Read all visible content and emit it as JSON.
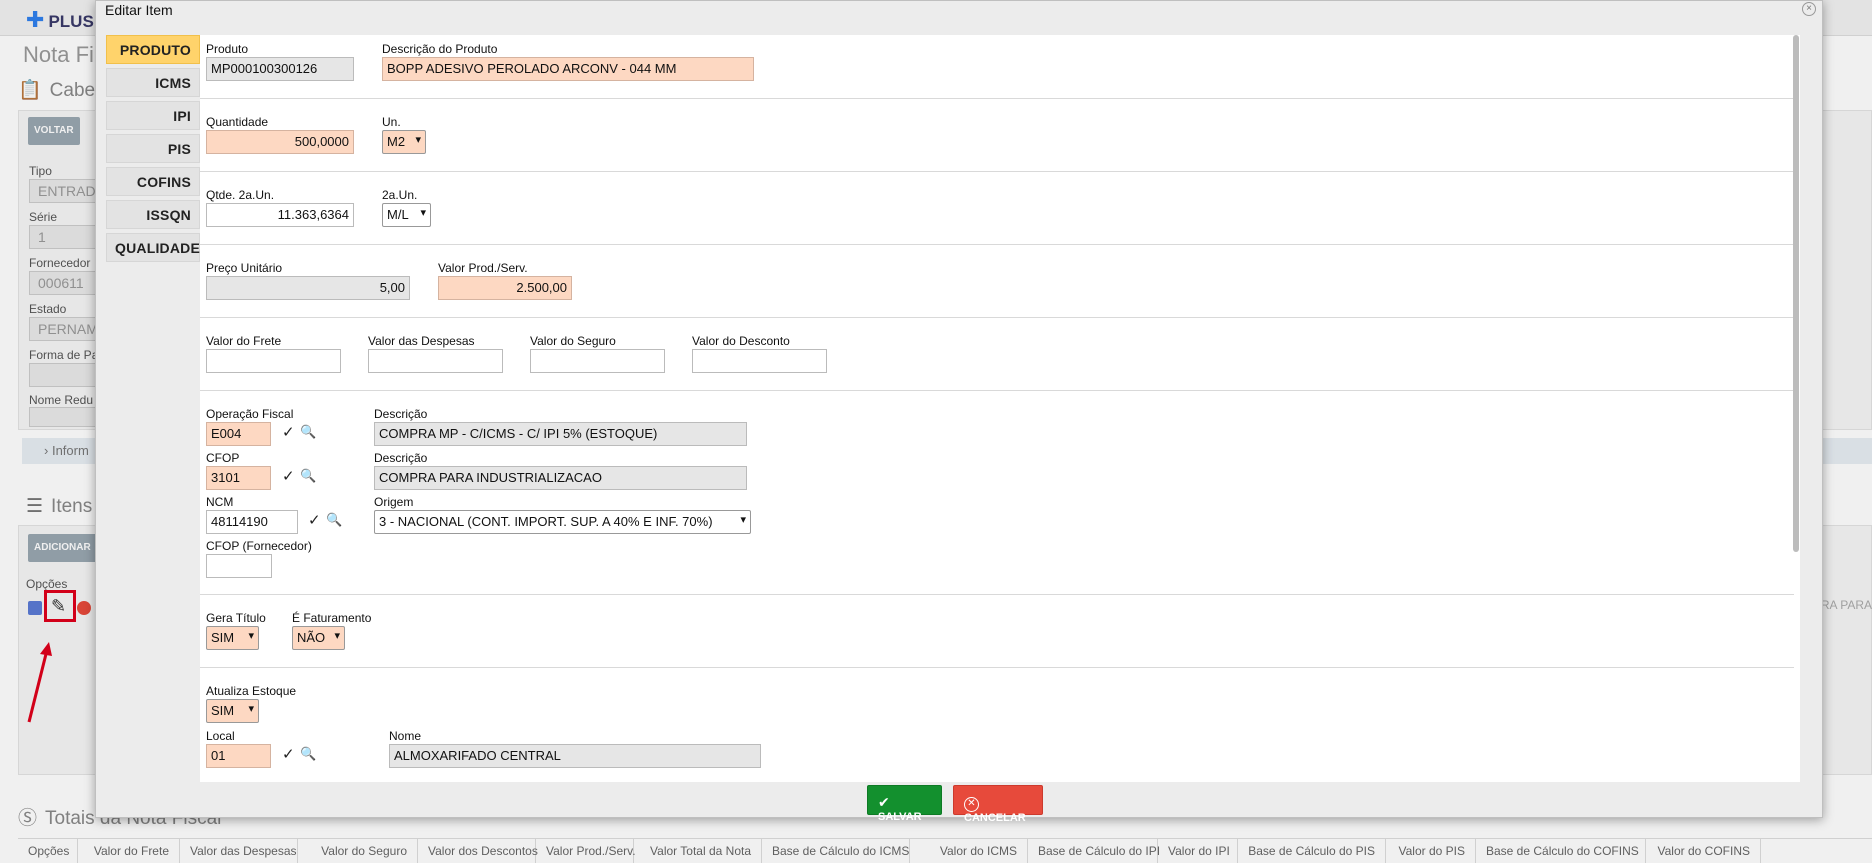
{
  "background": {
    "logo": "PLUS",
    "page_title": "Nota Fi",
    "section_cabecalho": "Cabe",
    "btn_voltar": "VOLTAR",
    "fields": [
      {
        "label": "Tipo",
        "value": "ENTRAD"
      },
      {
        "label": "Série",
        "value": "1"
      },
      {
        "label": "Fornecedor",
        "value": "000611"
      },
      {
        "label": "Estado",
        "value": "PERNAM"
      },
      {
        "label": "Forma de Pa",
        "value": ""
      },
      {
        "label": "Nome Redu",
        "value": ""
      }
    ],
    "info_link": "Inform",
    "section_itens": "Itens",
    "btn_adicionar": "ADICIONAR",
    "opcoes_label": "Opções",
    "right_partial": "RA PARA",
    "section_totais": "Totais da Nota Fiscal",
    "totals_columns": [
      "Opções",
      "Valor do Frete",
      "Valor das Despesas",
      "Valor do Seguro",
      "Valor dos Descontos",
      "Valor Prod./Serv.",
      "Valor Total da Nota",
      "Base de Cálculo do ICMS",
      "Valor do ICMS",
      "Base de Cálculo do IPI",
      "Valor do IPI",
      "Base de Cálculo do PIS",
      "Valor do PIS",
      "Base de Cálculo do COFINS",
      "Valor do COFINS"
    ]
  },
  "modal": {
    "title": "Editar Item",
    "close": "×",
    "tabs": [
      "PRODUTO",
      "ICMS",
      "IPI",
      "PIS",
      "COFINS",
      "ISSQN",
      "QUALIDADE"
    ],
    "active_tab": "PRODUTO",
    "produto": {
      "label": "Produto",
      "value": "MP000100300126"
    },
    "descricao_produto": {
      "label": "Descrição do Produto",
      "value": "BOPP ADESIVO PEROLADO ARCONV - 044 MM"
    },
    "quantidade": {
      "label": "Quantidade",
      "value": "500,0000"
    },
    "un": {
      "label": "Un.",
      "value": "M2"
    },
    "qtde_2a": {
      "label": "Qtde. 2a.Un.",
      "value": "11.363,6364"
    },
    "un_2a": {
      "label": "2a.Un.",
      "value": "M/L"
    },
    "preco_unitario": {
      "label": "Preço Unitário",
      "value": "5,00"
    },
    "valor_prod": {
      "label": "Valor Prod./Serv.",
      "value": "2.500,00"
    },
    "valor_frete": {
      "label": "Valor do Frete",
      "value": ""
    },
    "valor_despesas": {
      "label": "Valor das Despesas",
      "value": ""
    },
    "valor_seguro": {
      "label": "Valor do Seguro",
      "value": ""
    },
    "valor_desconto": {
      "label": "Valor do Desconto",
      "value": ""
    },
    "operacao_fiscal": {
      "label": "Operação Fiscal",
      "value": "E004"
    },
    "descricao_op": {
      "label": "Descrição",
      "value": "COMPRA MP - C/ICMS - C/ IPI 5% (ESTOQUE)"
    },
    "cfop": {
      "label": "CFOP",
      "value": "3101"
    },
    "descricao_cfop": {
      "label": "Descrição",
      "value": "COMPRA PARA INDUSTRIALIZACAO"
    },
    "ncm": {
      "label": "NCM",
      "value": "48114190"
    },
    "origem": {
      "label": "Origem",
      "value": "3 - NACIONAL (CONT. IMPORT. SUP. A 40% E INF. 70%)"
    },
    "cfop_fornecedor": {
      "label": "CFOP (Fornecedor)",
      "value": ""
    },
    "gera_titulo": {
      "label": "Gera Título",
      "value": "SIM"
    },
    "e_faturamento": {
      "label": "É Faturamento",
      "value": "NÃO"
    },
    "atualiza_estoque": {
      "label": "Atualiza Estoque",
      "value": "SIM"
    },
    "local": {
      "label": "Local",
      "value": "01"
    },
    "nome_local": {
      "label": "Nome",
      "value": "ALMOXARIFADO CENTRAL"
    },
    "buttons": {
      "save": "SALVAR",
      "cancel": "CANCELAR"
    }
  },
  "colors": {
    "required_field": "#fdd8c2",
    "active_tab": "#ffd36b",
    "save": "#13902e",
    "cancel": "#e74a3b",
    "highlight": "#e0001b"
  },
  "icons": {
    "confirm": "check-icon",
    "search": "magnifier-icon",
    "edit": "pencil-icon",
    "close": "close-icon"
  }
}
